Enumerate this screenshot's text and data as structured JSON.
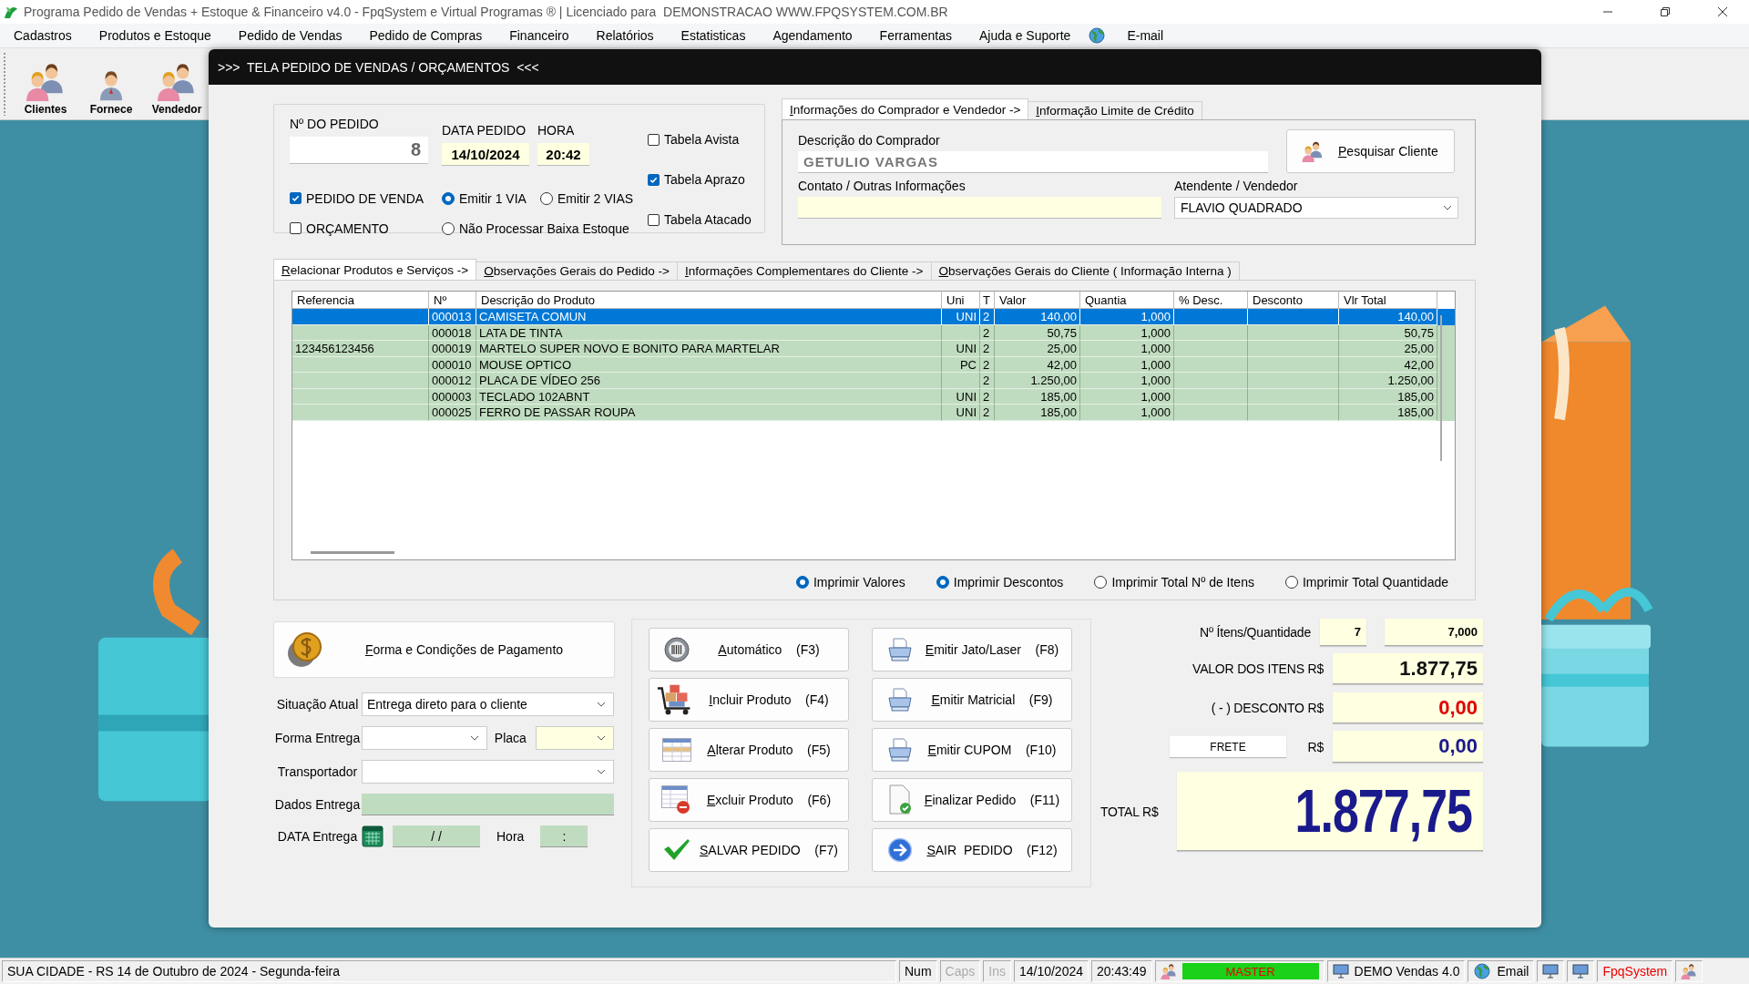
{
  "window": {
    "title": "Programa Pedido de Vendas + Estoque & Financeiro v4.0 - FpqSystem e Virtual Programas ® | Licenciado para  DEMONSTRACAO WWW.FPQSYSTEM.COM.BR"
  },
  "menu": [
    {
      "kind": "text",
      "label": "Cadastros"
    },
    {
      "kind": "text",
      "label": "Produtos e Estoque"
    },
    {
      "kind": "text",
      "label": "Pedido de Vendas"
    },
    {
      "kind": "text",
      "label": "Pedido de Compras"
    },
    {
      "kind": "text",
      "label": "Financeiro"
    },
    {
      "kind": "text",
      "label": "Relatórios"
    },
    {
      "kind": "text",
      "label": "Estatisticas"
    },
    {
      "kind": "text",
      "label": "Agendamento"
    },
    {
      "kind": "text",
      "label": "Ferramentas"
    },
    {
      "kind": "text",
      "label": "Ajuda e Suporte"
    },
    {
      "kind": "globe"
    },
    {
      "kind": "text",
      "label": "E-mail"
    }
  ],
  "toolbar": [
    {
      "label": "Clientes"
    },
    {
      "label": "Fornece"
    },
    {
      "label": "Vendedor"
    }
  ],
  "order_window": {
    "title": ">>>  TELA PEDIDO DE VENDAS / ORÇAMENTOS  <<<"
  },
  "order": {
    "number_label": "Nº DO PEDIDO",
    "number": "8",
    "date_label": "DATA PEDIDO",
    "date": "14/10/2024",
    "time_label": "HORA",
    "time": "20:42",
    "type_options": [
      {
        "label": "PEDIDO DE VENDA",
        "checked": true
      },
      {
        "label": "ORÇAMENTO",
        "checked": false
      }
    ],
    "copies": [
      {
        "label": "Emitir 1 VIA",
        "selected": true
      },
      {
        "label": "Emitir 2 VIAS",
        "selected": false
      }
    ],
    "stock_option": {
      "label": "Não Processar Baixa Estoque",
      "selected": false
    },
    "price_tables": [
      {
        "label": "Tabela Avista",
        "checked": false
      },
      {
        "label": "Tabela Aprazo",
        "checked": true
      },
      {
        "label": "Tabela Atacado",
        "checked": false
      }
    ]
  },
  "buyer_tabs": [
    {
      "label": "Informações do Comprador e Vendedor ->",
      "selected": true
    },
    {
      "label": "Informação Limite de Crédito",
      "selected": false
    }
  ],
  "buyer": {
    "name_label": "Descrição do Comprador",
    "name": "GETULIO VARGAS",
    "search_button": "Pesquisar Cliente",
    "contact_label": "Contato / Outras Informações",
    "seller_label": "Atendente / Vendedor",
    "seller": "FLAVIO QUADRADO"
  },
  "section_tabs": [
    {
      "label": "Relacionar Produtos e Serviços ->",
      "selected": true
    },
    {
      "label": "Observações Gerais do Pedido ->",
      "selected": false
    },
    {
      "label": "Informações Complementares do Cliente ->",
      "selected": false
    },
    {
      "label": "Observações Gerais do Cliente ( Informação Interna )",
      "selected": false
    }
  ],
  "table": {
    "columns": [
      "Referencia",
      "Nº",
      "Descrição do Produto",
      "Uni",
      "T",
      "Valor",
      "Quantia",
      "% Desc.",
      "Desconto",
      "Vlr Total"
    ],
    "rows": [
      {
        "selected": true,
        "cells": [
          null,
          "000013",
          "CAMISETA COMUN",
          "UNI",
          "2",
          "140,00",
          "1,000",
          null,
          null,
          "140,00"
        ]
      },
      {
        "selected": false,
        "cells": [
          null,
          "000018",
          "LATA DE TINTA",
          null,
          "2",
          "50,75",
          "1,000",
          null,
          null,
          "50,75"
        ]
      },
      {
        "selected": false,
        "cells": [
          "123456123456",
          "000019",
          "MARTELO SUPER NOVO E BONITO PARA MARTELAR",
          "UNI",
          "2",
          "25,00",
          "1,000",
          null,
          null,
          "25,00"
        ]
      },
      {
        "selected": false,
        "cells": [
          null,
          "000010",
          "MOUSE OPTICO",
          "PC",
          "2",
          "42,00",
          "1,000",
          null,
          null,
          "42,00"
        ]
      },
      {
        "selected": false,
        "cells": [
          null,
          "000012",
          "PLACA DE VÍDEO 256",
          null,
          "2",
          "1.250,00",
          "1,000",
          null,
          null,
          "1.250,00"
        ]
      },
      {
        "selected": false,
        "cells": [
          null,
          "000003",
          "TECLADO 102ABNT",
          "UNI",
          "2",
          "185,00",
          "1,000",
          null,
          null,
          "185,00"
        ]
      },
      {
        "selected": false,
        "cells": [
          null,
          "000025",
          "FERRO DE PASSAR ROUPA",
          "UNI",
          "2",
          "185,00",
          "1,000",
          null,
          null,
          "185,00"
        ]
      }
    ]
  },
  "print_options": [
    {
      "label": "Imprimir Valores",
      "selected": true
    },
    {
      "label": "Imprimir Descontos",
      "selected": true
    },
    {
      "label": "Imprimir Total Nº de Itens",
      "selected": false
    },
    {
      "label": "Imprimir Total Quantidade",
      "selected": false
    }
  ],
  "payment_button": "Forma e Condições de Pagamento",
  "delivery": {
    "status_label": "Situação Atual",
    "status": "Entrega direto para o cliente",
    "method_label": "Forma Entrega",
    "plate_label": "Placa",
    "carrier_label": "Transportador",
    "data_label": "Dados Entrega",
    "date_label": "DATA Entrega",
    "date": "/ /",
    "time_label": "Hora",
    "time": ":"
  },
  "actions": [
    {
      "label": "Automático",
      "key": "(F3)"
    },
    {
      "label": "Emitir Jato/Laser",
      "key": "(F8)"
    },
    {
      "label": "Incluir Produto",
      "key": "(F4)"
    },
    {
      "label": "Emitir Matricial",
      "key": "(F9)"
    },
    {
      "label": "Alterar Produto",
      "key": "(F5)"
    },
    {
      "label": "Emitir CUPOM",
      "key": "(F10)"
    },
    {
      "label": "Excluir Produto",
      "key": "(F6)"
    },
    {
      "label": "Finalizar Pedido",
      "key": "(F11)"
    },
    {
      "label": "SALVAR PEDIDO",
      "key": "(F7)"
    },
    {
      "label": "SAIR  PEDIDO",
      "key": "(F12)"
    }
  ],
  "totals": {
    "count_label": "Nº Ítens/Quantidade",
    "count": "7",
    "quantity": "7,000",
    "items_label": "VALOR DOS ITENS R$",
    "items": "1.877,75",
    "discount_label": "( - ) DESCONTO R$",
    "discount": "0,00",
    "freight_button": "FRETE",
    "freight_label": "R$",
    "freight": "0,00",
    "total_label": "TOTAL R$",
    "total": "1.877,75"
  },
  "status_bar": {
    "location": "SUA CIDADE - RS 14 de Outubro de 2024 - Segunda-feira",
    "keys": [
      {
        "label": "Num",
        "disabled": false
      },
      {
        "label": "Caps",
        "disabled": true
      },
      {
        "label": "Ins",
        "disabled": true
      }
    ],
    "date": "14/10/2024",
    "time": "20:43:49",
    "user": "MASTER",
    "version": "DEMO Vendas 4.0",
    "email": "Email",
    "brand": "FpqSystem"
  }
}
